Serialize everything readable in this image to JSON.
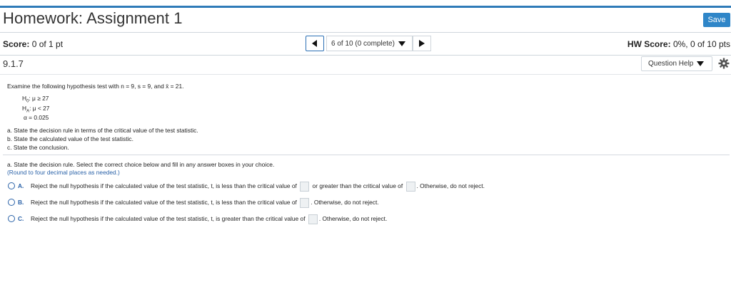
{
  "header": {
    "title": "Homework: Assignment 1",
    "save_label": "Save"
  },
  "score_bar": {
    "score_label": "Score:",
    "score_value": "0 of 1 pt",
    "nav_label": "6 of 10 (0 complete)",
    "hw_score_label": "HW Score:",
    "hw_score_value": "0%, 0 of 10 pts"
  },
  "question_bar": {
    "number": "9.1.7",
    "help_label": "Question Help"
  },
  "problem": {
    "intro": "Examine the following hypothesis test with n = 9, s = 9, and",
    "intro_xbar": "x̄ = 21.",
    "h0_label": "H",
    "h0_sub": "0",
    "h0_text": ": μ ≥ 27",
    "ha_label": "H",
    "ha_sub": "A",
    "ha_text": ": μ < 27",
    "alpha": "α = 0.025",
    "part_a": "a. State the decision rule in terms of the critical value of the test statistic.",
    "part_b": "b. State the calculated value of the test statistic.",
    "part_c": "c. State the conclusion."
  },
  "answer": {
    "prompt": "a. State the decision rule. Select the correct choice below and fill in any answer boxes in your choice.",
    "rounding": "(Round to four decimal places as needed.)",
    "choices": [
      {
        "letter": "A.",
        "text1": "Reject the null hypothesis if the calculated value of the test statistic, t, is less than the critical value of",
        "text2": "or greater than the critical value of",
        "text3": ". Otherwise, do not reject."
      },
      {
        "letter": "B.",
        "text1": "Reject the null hypothesis if the calculated value of the test statistic, t, is less than the critical value of",
        "text2": ". Otherwise, do not reject."
      },
      {
        "letter": "C.",
        "text1": "Reject the null hypothesis if the calculated value of the test statistic, t, is greater than the critical value of",
        "text2": ". Otherwise, do not reject."
      }
    ]
  },
  "icons": {
    "prev": "arrow-left-icon",
    "next": "arrow-right-icon",
    "caret": "caret-down-icon",
    "settings": "gear-icon"
  },
  "colors": {
    "accent": "#2e7bb8",
    "save_button": "#2f86c8",
    "choice_blue": "#2a62a8"
  }
}
